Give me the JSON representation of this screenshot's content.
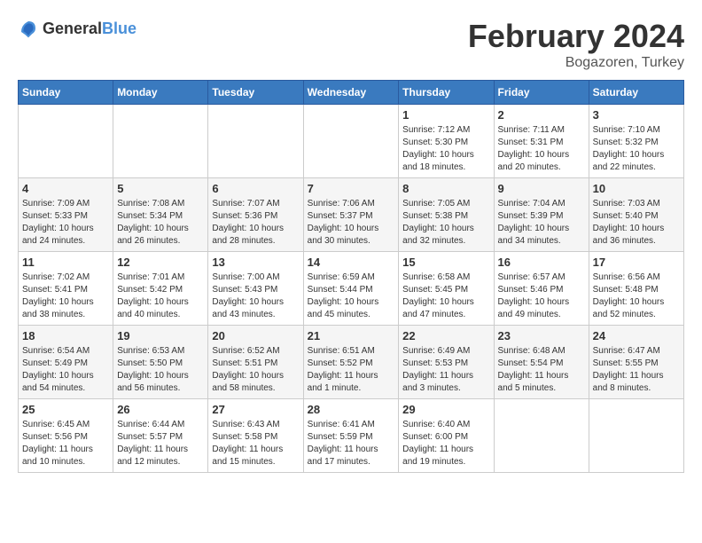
{
  "header": {
    "logo_general": "General",
    "logo_blue": "Blue",
    "month_title": "February 2024",
    "subtitle": "Bogazoren, Turkey"
  },
  "weekdays": [
    "Sunday",
    "Monday",
    "Tuesday",
    "Wednesday",
    "Thursday",
    "Friday",
    "Saturday"
  ],
  "weeks": [
    [
      {
        "day": "",
        "sunrise": "",
        "sunset": "",
        "daylight": ""
      },
      {
        "day": "",
        "sunrise": "",
        "sunset": "",
        "daylight": ""
      },
      {
        "day": "",
        "sunrise": "",
        "sunset": "",
        "daylight": ""
      },
      {
        "day": "",
        "sunrise": "",
        "sunset": "",
        "daylight": ""
      },
      {
        "day": "1",
        "sunrise": "Sunrise: 7:12 AM",
        "sunset": "Sunset: 5:30 PM",
        "daylight": "Daylight: 10 hours and 18 minutes."
      },
      {
        "day": "2",
        "sunrise": "Sunrise: 7:11 AM",
        "sunset": "Sunset: 5:31 PM",
        "daylight": "Daylight: 10 hours and 20 minutes."
      },
      {
        "day": "3",
        "sunrise": "Sunrise: 7:10 AM",
        "sunset": "Sunset: 5:32 PM",
        "daylight": "Daylight: 10 hours and 22 minutes."
      }
    ],
    [
      {
        "day": "4",
        "sunrise": "Sunrise: 7:09 AM",
        "sunset": "Sunset: 5:33 PM",
        "daylight": "Daylight: 10 hours and 24 minutes."
      },
      {
        "day": "5",
        "sunrise": "Sunrise: 7:08 AM",
        "sunset": "Sunset: 5:34 PM",
        "daylight": "Daylight: 10 hours and 26 minutes."
      },
      {
        "day": "6",
        "sunrise": "Sunrise: 7:07 AM",
        "sunset": "Sunset: 5:36 PM",
        "daylight": "Daylight: 10 hours and 28 minutes."
      },
      {
        "day": "7",
        "sunrise": "Sunrise: 7:06 AM",
        "sunset": "Sunset: 5:37 PM",
        "daylight": "Daylight: 10 hours and 30 minutes."
      },
      {
        "day": "8",
        "sunrise": "Sunrise: 7:05 AM",
        "sunset": "Sunset: 5:38 PM",
        "daylight": "Daylight: 10 hours and 32 minutes."
      },
      {
        "day": "9",
        "sunrise": "Sunrise: 7:04 AM",
        "sunset": "Sunset: 5:39 PM",
        "daylight": "Daylight: 10 hours and 34 minutes."
      },
      {
        "day": "10",
        "sunrise": "Sunrise: 7:03 AM",
        "sunset": "Sunset: 5:40 PM",
        "daylight": "Daylight: 10 hours and 36 minutes."
      }
    ],
    [
      {
        "day": "11",
        "sunrise": "Sunrise: 7:02 AM",
        "sunset": "Sunset: 5:41 PM",
        "daylight": "Daylight: 10 hours and 38 minutes."
      },
      {
        "day": "12",
        "sunrise": "Sunrise: 7:01 AM",
        "sunset": "Sunset: 5:42 PM",
        "daylight": "Daylight: 10 hours and 40 minutes."
      },
      {
        "day": "13",
        "sunrise": "Sunrise: 7:00 AM",
        "sunset": "Sunset: 5:43 PM",
        "daylight": "Daylight: 10 hours and 43 minutes."
      },
      {
        "day": "14",
        "sunrise": "Sunrise: 6:59 AM",
        "sunset": "Sunset: 5:44 PM",
        "daylight": "Daylight: 10 hours and 45 minutes."
      },
      {
        "day": "15",
        "sunrise": "Sunrise: 6:58 AM",
        "sunset": "Sunset: 5:45 PM",
        "daylight": "Daylight: 10 hours and 47 minutes."
      },
      {
        "day": "16",
        "sunrise": "Sunrise: 6:57 AM",
        "sunset": "Sunset: 5:46 PM",
        "daylight": "Daylight: 10 hours and 49 minutes."
      },
      {
        "day": "17",
        "sunrise": "Sunrise: 6:56 AM",
        "sunset": "Sunset: 5:48 PM",
        "daylight": "Daylight: 10 hours and 52 minutes."
      }
    ],
    [
      {
        "day": "18",
        "sunrise": "Sunrise: 6:54 AM",
        "sunset": "Sunset: 5:49 PM",
        "daylight": "Daylight: 10 hours and 54 minutes."
      },
      {
        "day": "19",
        "sunrise": "Sunrise: 6:53 AM",
        "sunset": "Sunset: 5:50 PM",
        "daylight": "Daylight: 10 hours and 56 minutes."
      },
      {
        "day": "20",
        "sunrise": "Sunrise: 6:52 AM",
        "sunset": "Sunset: 5:51 PM",
        "daylight": "Daylight: 10 hours and 58 minutes."
      },
      {
        "day": "21",
        "sunrise": "Sunrise: 6:51 AM",
        "sunset": "Sunset: 5:52 PM",
        "daylight": "Daylight: 11 hours and 1 minute."
      },
      {
        "day": "22",
        "sunrise": "Sunrise: 6:49 AM",
        "sunset": "Sunset: 5:53 PM",
        "daylight": "Daylight: 11 hours and 3 minutes."
      },
      {
        "day": "23",
        "sunrise": "Sunrise: 6:48 AM",
        "sunset": "Sunset: 5:54 PM",
        "daylight": "Daylight: 11 hours and 5 minutes."
      },
      {
        "day": "24",
        "sunrise": "Sunrise: 6:47 AM",
        "sunset": "Sunset: 5:55 PM",
        "daylight": "Daylight: 11 hours and 8 minutes."
      }
    ],
    [
      {
        "day": "25",
        "sunrise": "Sunrise: 6:45 AM",
        "sunset": "Sunset: 5:56 PM",
        "daylight": "Daylight: 11 hours and 10 minutes."
      },
      {
        "day": "26",
        "sunrise": "Sunrise: 6:44 AM",
        "sunset": "Sunset: 5:57 PM",
        "daylight": "Daylight: 11 hours and 12 minutes."
      },
      {
        "day": "27",
        "sunrise": "Sunrise: 6:43 AM",
        "sunset": "Sunset: 5:58 PM",
        "daylight": "Daylight: 11 hours and 15 minutes."
      },
      {
        "day": "28",
        "sunrise": "Sunrise: 6:41 AM",
        "sunset": "Sunset: 5:59 PM",
        "daylight": "Daylight: 11 hours and 17 minutes."
      },
      {
        "day": "29",
        "sunrise": "Sunrise: 6:40 AM",
        "sunset": "Sunset: 6:00 PM",
        "daylight": "Daylight: 11 hours and 19 minutes."
      },
      {
        "day": "",
        "sunrise": "",
        "sunset": "",
        "daylight": ""
      },
      {
        "day": "",
        "sunrise": "",
        "sunset": "",
        "daylight": ""
      }
    ]
  ]
}
